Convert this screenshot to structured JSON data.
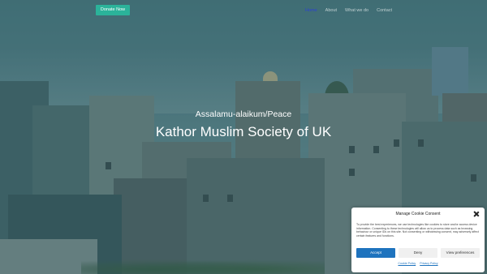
{
  "header": {
    "donate_label": "Donate Now",
    "nav": [
      {
        "label": "Home",
        "active": true
      },
      {
        "label": "About",
        "active": false
      },
      {
        "label": "What we do",
        "active": false
      },
      {
        "label": "Contact",
        "active": false
      }
    ]
  },
  "hero": {
    "greeting": "Assalamu-alaikum/Peace",
    "title": "Kathor Muslim Society of UK"
  },
  "cookie": {
    "title": "Manage Cookie Consent",
    "body": "To provide the best experiences, we use technologies like cookies to store and/or access device information. Consenting to these technologies will allow us to process data such as browsing behaviour or unique IDs on this site. Not consenting or withdrawing consent, may adversely affect certain features and functions.",
    "accept_label": "Accept",
    "deny_label": "Deny",
    "prefs_label": "View preferences",
    "policy_link": "Cookie Policy",
    "privacy_link": "Privacy Policy",
    "close_icon": "close-icon"
  },
  "colors": {
    "accent": "#2bb39a",
    "nav_active": "#2b3fd6",
    "accept_button": "#1e73be"
  }
}
